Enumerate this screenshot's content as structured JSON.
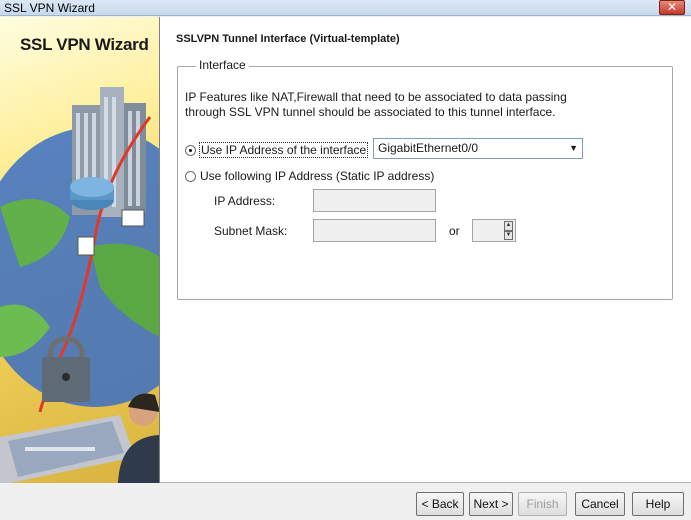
{
  "window": {
    "title": "SSL VPN Wizard",
    "close_glyph": "✕"
  },
  "side_panel": {
    "title": "SSL VPN Wizard"
  },
  "page": {
    "section_title": "SSLVPN Tunnel Interface (Virtual-template)",
    "group_label": "Interface",
    "description_line1": "IP Features like NAT,Firewall that need to be associated to data passing",
    "description_line2": "through SSL VPN tunnel should be associated to this tunnel interface.",
    "option_interface": {
      "label": "Use IP Address of the interface",
      "selected": true,
      "interface_value": "GigabitEthernet0/0"
    },
    "option_static": {
      "label": "Use following IP Address (Static IP address)",
      "selected": false,
      "ip_label": "IP Address:",
      "ip_value": "",
      "mask_label": "Subnet Mask:",
      "mask_value": "",
      "or_label": "or",
      "prefix_value": ""
    }
  },
  "buttons": {
    "back": "< Back",
    "next": "Next >",
    "finish": "Finish",
    "cancel": "Cancel",
    "help": "Help"
  },
  "icons": {
    "dropdown": "triangle-down-icon",
    "spin_up": "triangle-up-icon",
    "spin_down": "triangle-down-icon"
  }
}
